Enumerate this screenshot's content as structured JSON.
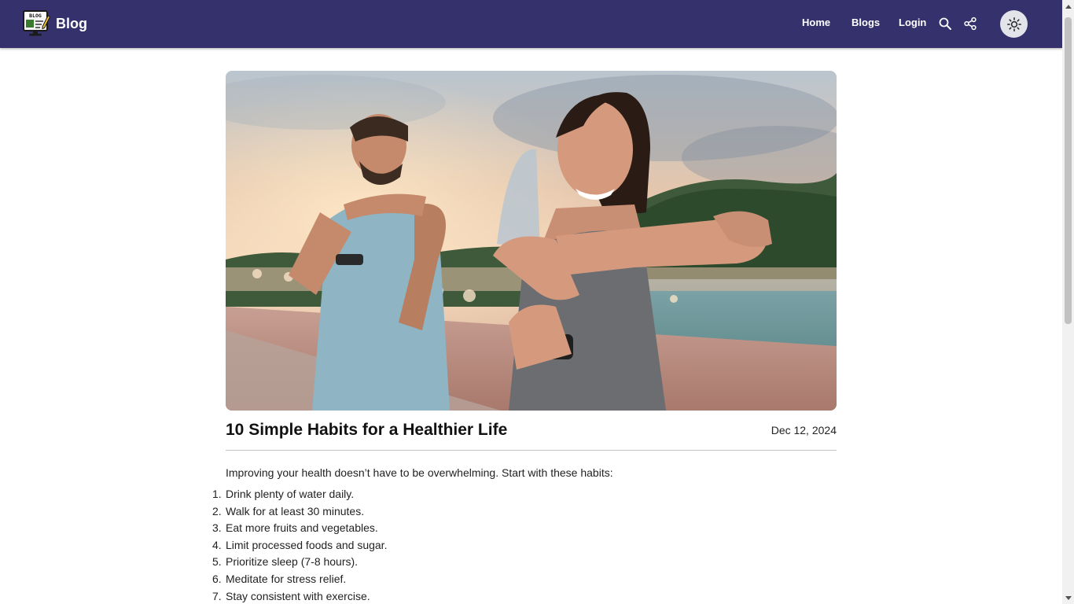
{
  "header": {
    "brand_name": "Blog",
    "logo_text": "BLOG",
    "nav": {
      "home": "Home",
      "blogs": "Blogs",
      "login": "Login"
    },
    "icons": [
      "search-icon",
      "share-icon",
      "sun-icon"
    ],
    "background_color": "#34316c"
  },
  "article": {
    "title": "10 Simple Habits for a Healthier Life",
    "date": "Dec 12, 2024",
    "intro": "Improving your health doesn’t have to be overwhelming. Start with these habits:",
    "habits": [
      "Drink plenty of water daily.",
      "Walk for at least 30 minutes.",
      "Eat more fruits and vegetables.",
      "Limit processed foods and sugar.",
      "Prioritize sleep (7-8 hours).",
      "Meditate for stress relief.",
      "Stay consistent with exercise."
    ]
  },
  "hero_image": {
    "subject": "man and woman stretching arms outdoors on a bridge at sunset"
  }
}
